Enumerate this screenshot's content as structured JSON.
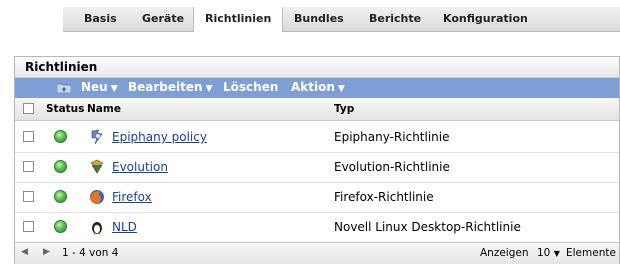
{
  "tabs": [
    "Basis",
    "Geräte",
    "Richtlinien",
    "Bundles",
    "Berichte",
    "Konfiguration"
  ],
  "active_tab": "Richtlinien",
  "panel": {
    "title": "Richtlinien",
    "toolbar": {
      "new": "Neu",
      "edit": "Bearbeiten",
      "delete": "Löschen",
      "action": "Aktion"
    },
    "columns": {
      "status": "Status",
      "name": "Name",
      "type": "Typ"
    },
    "rows": [
      {
        "name": "Epiphany policy",
        "type": "Epiphany-Richtlinie",
        "icon": "epiphany-icon"
      },
      {
        "name": "Evolution",
        "type": "Evolution-Richtlinie",
        "icon": "evolution-icon"
      },
      {
        "name": "Firefox",
        "type": "Firefox-Richtlinie",
        "icon": "firefox-icon"
      },
      {
        "name": "NLD",
        "type": "Novell Linux Desktop-Richtlinie",
        "icon": "penguin-icon"
      }
    ],
    "footer": {
      "range": "1 - 4 von 4",
      "show_label": "Anzeigen",
      "page_size": "10",
      "unit": "Elemente"
    }
  },
  "colors": {
    "toolbar": "#7f9fd4",
    "link": "#1c3f9b",
    "status_ok": "#57c14c"
  }
}
